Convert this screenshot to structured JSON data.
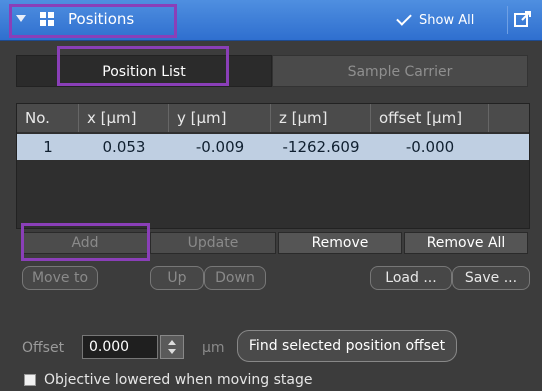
{
  "header": {
    "title": "Positions",
    "show_all_label": "Show All",
    "accent": "#3f7fd8",
    "icons": [
      "chevron-down-icon",
      "grid-icon",
      "check-icon",
      "popout-icon"
    ]
  },
  "tabs": [
    {
      "label": "Position List",
      "active": true
    },
    {
      "label": "Sample Carrier",
      "active": false
    }
  ],
  "table": {
    "columns": [
      "No.",
      "x [µm]",
      "y [µm]",
      "z [µm]",
      "offset [µm]"
    ],
    "rows": [
      {
        "no": "1",
        "x": "0.053",
        "y": "-0.009",
        "z": "-1262.609",
        "offset": "-0.000"
      }
    ],
    "selected_row_color": "#bfcfe2"
  },
  "actions": {
    "add": "Add",
    "update": "Update",
    "remove": "Remove",
    "remove_all": "Remove All"
  },
  "nav": {
    "move_to": "Move to",
    "up": "Up",
    "down": "Down",
    "load": "Load ...",
    "save": "Save ..."
  },
  "offset": {
    "label": "Offset",
    "value": "0.000",
    "unit": "µm",
    "find_button": "Find selected position offset"
  },
  "options": {
    "objective_lowered_label": "Objective lowered when moving stage",
    "objective_lowered_checked": false
  }
}
